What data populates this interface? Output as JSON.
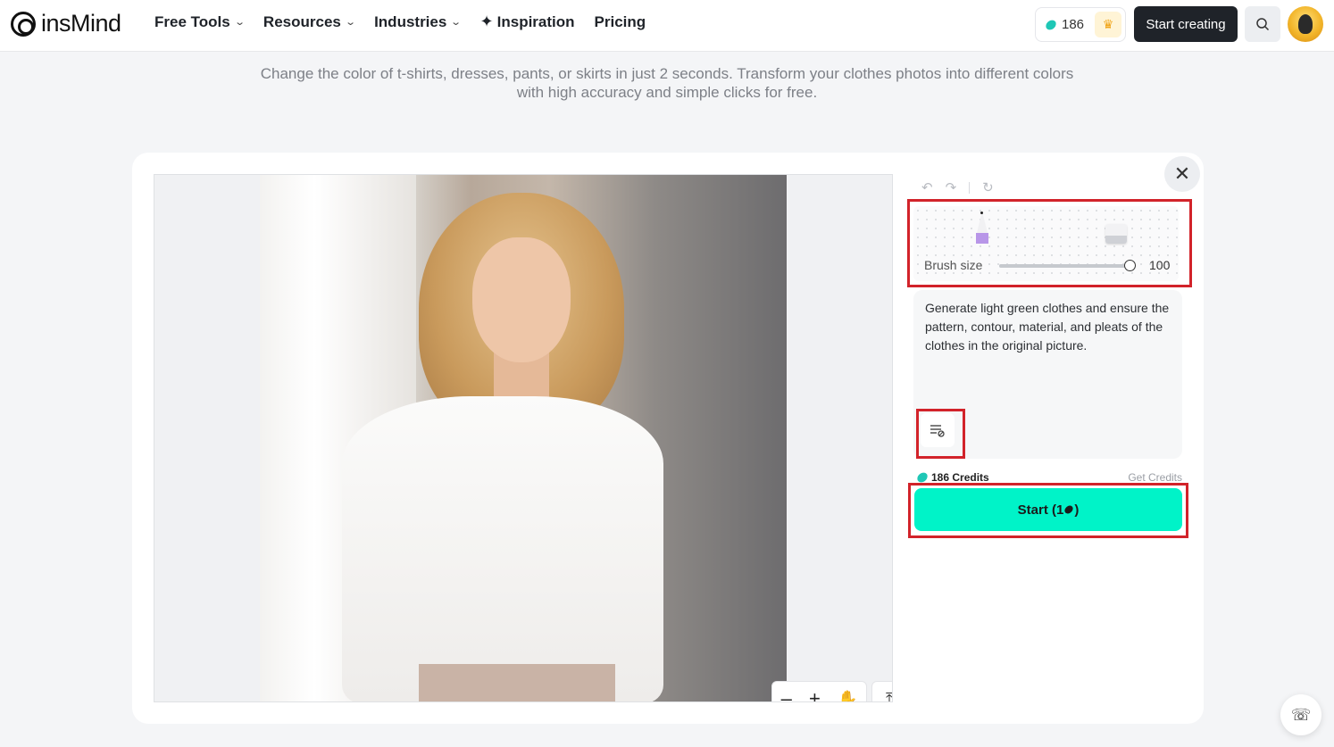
{
  "brand": {
    "name": "insMind"
  },
  "nav": {
    "items": [
      {
        "label": "Free Tools",
        "has_dropdown": true
      },
      {
        "label": "Resources",
        "has_dropdown": true
      },
      {
        "label": "Industries",
        "has_dropdown": true
      },
      {
        "label": "Inspiration",
        "has_dropdown": false,
        "icon": "sparkle-icon"
      },
      {
        "label": "Pricing",
        "has_dropdown": false
      }
    ],
    "credits": "186",
    "start_creating": "Start creating"
  },
  "subtitle": {
    "line1": "Change the color of t-shirts, dresses, pants, or skirts in just 2 seconds. Transform your clothes photos into different colors",
    "line2": "with high accuracy and simple clicks for free."
  },
  "editor": {
    "brush": {
      "label": "Brush size",
      "value": "100",
      "level": 1.0
    },
    "prompt": "Generate light green clothes and ensure the pattern, contour, material, and pleats of the clothes in the original picture.",
    "credits_label": "186 Credits",
    "get_credits": "Get Credits",
    "start_label": "Start (1",
    "start_suffix": ")"
  },
  "colors": {
    "accent": "#00f3c8",
    "dark_button": "#1f2329",
    "highlight": "#d2232a",
    "brush_pencil": "#b896e8"
  }
}
